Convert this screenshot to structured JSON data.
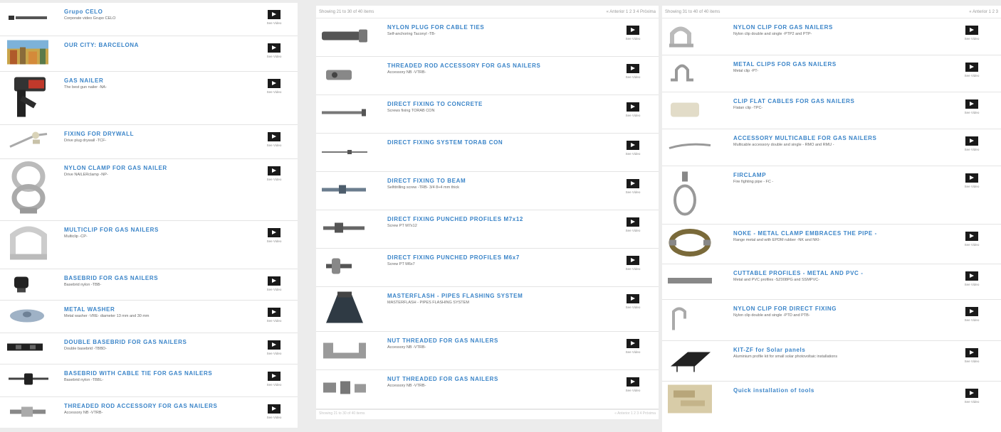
{
  "panel1": {
    "items": [
      {
        "title": "Grupo CELO",
        "subtitle": "Corporate video Grupo CELO",
        "video_label": "See Video",
        "icon": "logo-thumb"
      },
      {
        "title": "OUR CITY: BARCELONA",
        "subtitle": "",
        "video_label": "See Video",
        "icon": "city-photo-thumb"
      },
      {
        "title": "GAS NAILER",
        "subtitle": "The best gun nailer -NA-",
        "video_label": "See Video",
        "icon": "nail-gun-thumb"
      },
      {
        "title": "FIXING FOR DRYWALL",
        "subtitle": "Drive plug drywall -TCF-",
        "video_label": "See Video",
        "icon": "drywall-fixing-thumb"
      },
      {
        "title": "NYLON CLAMP FOR GAS NAILER",
        "subtitle": "Drive NAILERclamp -NP-",
        "video_label": "See Video",
        "icon": "nylon-clamp-thumb"
      },
      {
        "title": "MULTICLIP FOR GAS NAILERS",
        "subtitle": "Multiclip -CP-",
        "video_label": "See Video",
        "icon": "multiclip-thumb"
      },
      {
        "title": "BASEBRID FOR GAS NAILERS",
        "subtitle": "Basebrid nylon -TBB-",
        "video_label": "See Video",
        "icon": "basebrid-thumb"
      },
      {
        "title": "METAL WASHER",
        "subtitle": "Metal washer -VRE- diameter 13 mm and 30 mm",
        "video_label": "See Video",
        "icon": "metal-washer-thumb"
      },
      {
        "title": "DOUBLE BASEBRID FOR GAS NAILERS",
        "subtitle": "Double basebrid -TBBD-",
        "video_label": "See Video",
        "icon": "double-basebrid-thumb"
      },
      {
        "title": "BASEBRID WITH CABLE TIE FOR GAS NAILERS",
        "subtitle": "Basebrid nylon -TBBL-",
        "video_label": "See Video",
        "icon": "basebrid-cable-tie-thumb"
      },
      {
        "title": "THREADED ROD ACCESSORY FOR GAS NAILERS",
        "subtitle": "Accessory NB -VTRB-",
        "video_label": "See Video",
        "icon": "threaded-rod-thumb"
      }
    ]
  },
  "panel2": {
    "header_left": "Showing 21 to 30 of 40 items",
    "header_right": "« Anterior 1 2 3 4 Próxima",
    "footer_left": "Showing 21 to 30 of 40 items",
    "footer_right": "« Anterior 1 2 3 4 Próxima",
    "items": [
      {
        "title": "NYLON PLUG FOR CABLE TIES",
        "subtitle": "Self-anchoring Taconyl -TB-",
        "video_label": "See Video",
        "icon": "nylon-plug-thumb"
      },
      {
        "title": "THREADED ROD ACCESSORY FOR GAS NAILERS",
        "subtitle": "Accessory NB -VTRB-",
        "video_label": "See Video",
        "icon": "threaded-rod-thumb"
      },
      {
        "title": "DIRECT FIXING TO CONCRETE",
        "subtitle": "Screws fixing TORAB CON",
        "video_label": "See Video",
        "icon": "concrete-screw-thumb"
      },
      {
        "title": "DIRECT FIXING SYSTEM TORAB CON",
        "subtitle": "",
        "video_label": "See Video",
        "icon": "torab-screw-thumb"
      },
      {
        "title": "DIRECT FIXING TO BEAM",
        "subtitle": "Selfdrilling screw -TRB- 3/4 8+4 mm thick",
        "video_label": "See Video",
        "icon": "beam-screw-thumb"
      },
      {
        "title": "DIRECT FIXING PUNCHED PROFILES M7x12",
        "subtitle": "Screw PT M7x12",
        "video_label": "See Video",
        "icon": "punched-profile-screw-thumb"
      },
      {
        "title": "DIRECT FIXING PUNCHED PROFILES M6x7",
        "subtitle": "Screw PT M6x7",
        "video_label": "See Video",
        "icon": "punched-profile-clip-thumb"
      },
      {
        "title": "MASTERFLASH - PIPES FLASHING SYSTEM",
        "subtitle": "MASTERFLASH - PIPES FLASHING SYSTEM",
        "video_label": "See Video",
        "icon": "masterflash-thumb"
      },
      {
        "title": "NUT THREADED FOR GAS NAILERS",
        "subtitle": "Accessory NB -VTRB-",
        "video_label": "See Video",
        "icon": "nut-bracket-thumb"
      },
      {
        "title": "NUT THREADED FOR GAS NAILERS",
        "subtitle": "Accessory NB -VTRB-",
        "video_label": "See Video",
        "icon": "nut-set-thumb"
      }
    ]
  },
  "panel3": {
    "header_left": "Showing 31 to 40 of 40 items",
    "header_right": "« Anterior 1 2 3",
    "items": [
      {
        "title": "NYLON CLIP FOR GAS NAILERS",
        "subtitle": "Nylon clip double and single -PTP2 and PTP-",
        "video_label": "See Video",
        "icon": "nylon-clip-thumb"
      },
      {
        "title": "METAL CLIPS FOR GAS NAILERS",
        "subtitle": "Metal clip -PT-",
        "video_label": "See Video",
        "icon": "metal-clip-thumb"
      },
      {
        "title": "CLIP FLAT CABLES FOR GAS NAILERS",
        "subtitle": "Flatan clip -TPC-",
        "video_label": "See Video",
        "icon": "flat-cable-clip-thumb"
      },
      {
        "title": "ACCESSORY MULTICABLE FOR GAS NAILERS",
        "subtitle": "Multicable accessory double and single - RMO and RMU -",
        "video_label": "See Video",
        "icon": "multicable-thumb"
      },
      {
        "title": "FIRCLAMP",
        "subtitle": "Fire fighting pipe - FC -",
        "video_label": "See Video",
        "icon": "firclamp-thumb"
      },
      {
        "title": "NOKE - METAL CLAMP EMBRACES THE PIPE -",
        "subtitle": "Range metal and with EPDM rubber -NK and NKI-",
        "video_label": "See Video",
        "icon": "metal-clamp-thumb"
      },
      {
        "title": "CUTTABLE PROFILES - METAL AND PVC -",
        "subtitle": "Metal and PVC profiles -SZ008PG and SSMPVC-",
        "video_label": "See Video",
        "icon": "cuttable-profile-thumb"
      },
      {
        "title": "NYLON CLIP FOR DIRECT FIXING",
        "subtitle": "Nylon clip double and single -PTD and PTB-",
        "video_label": "See Video",
        "icon": "nylon-direct-clip-thumb"
      },
      {
        "title": "KIT-ZF for Solar panels",
        "subtitle": "Aluminium profile kit for small solar photovoltaic installations",
        "video_label": "See Video",
        "icon": "solar-panel-thumb"
      },
      {
        "title": "Quick installation of tools",
        "subtitle": "",
        "video_label": "See Video",
        "icon": "tools-install-thumb"
      }
    ]
  }
}
